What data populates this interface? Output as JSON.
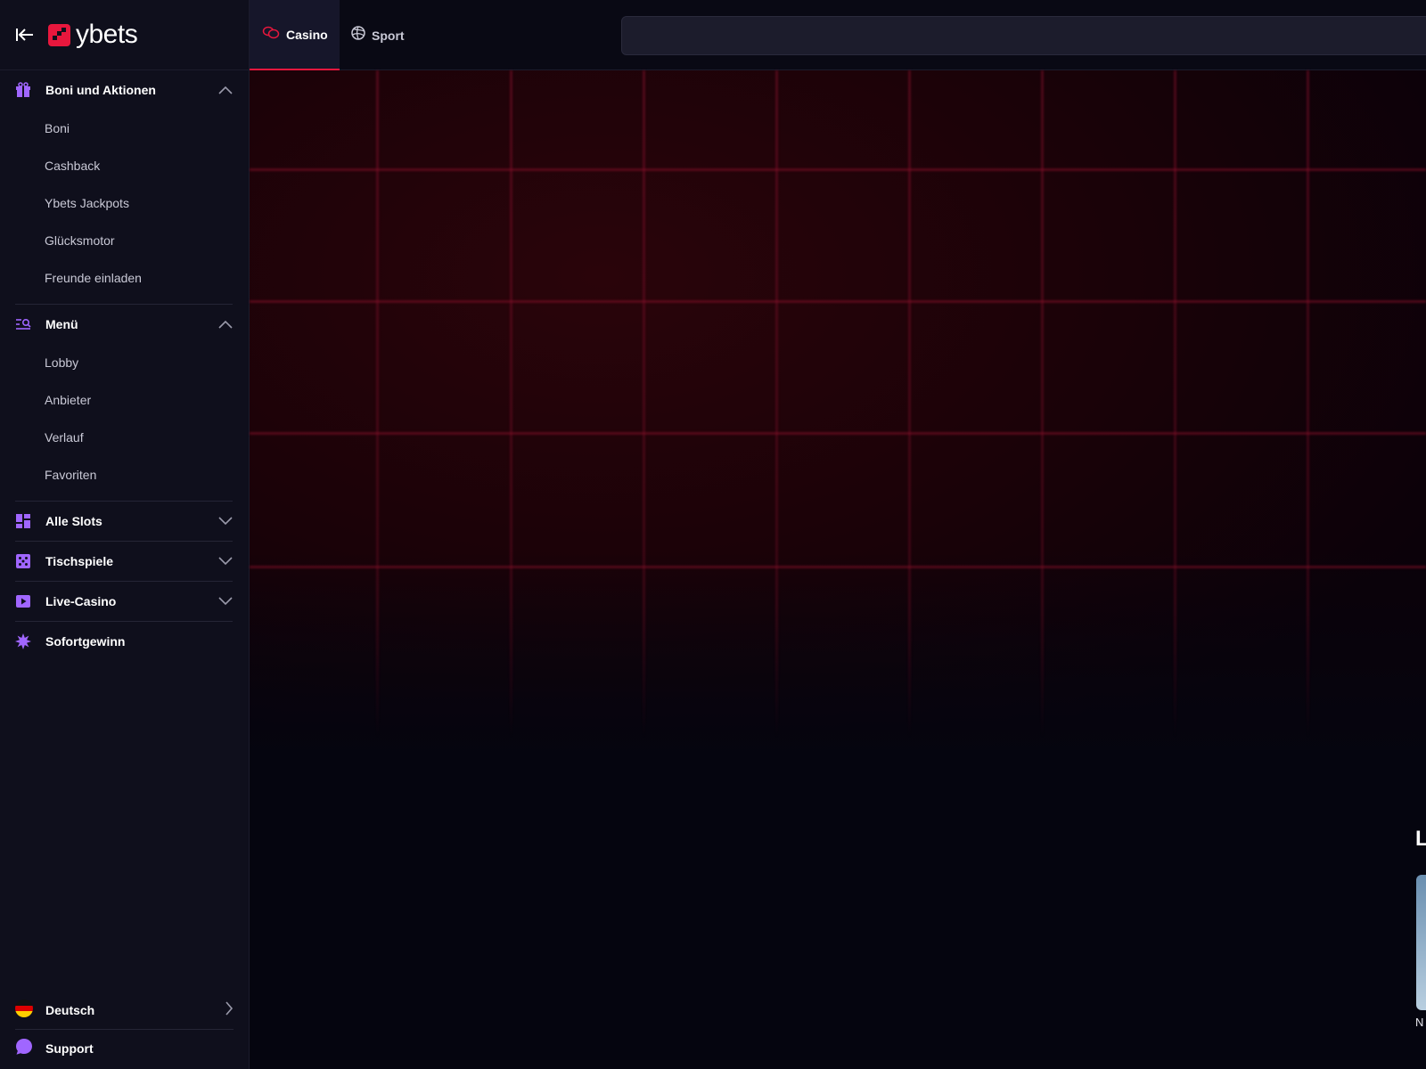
{
  "brand": {
    "name": "ybets",
    "accent": "#e8173d",
    "icon_accent": "#a066ff"
  },
  "topbar": {
    "tabs": [
      {
        "label": "Casino",
        "icon": "casino-chips-icon",
        "active": true
      },
      {
        "label": "Sport",
        "icon": "volleyball-icon",
        "active": false
      }
    ],
    "search": {
      "placeholder": "",
      "value": ""
    }
  },
  "sidebar": {
    "bonuses": {
      "label": "Boni und Aktionen",
      "icon": "gift-icon",
      "expanded": true,
      "items": [
        "Boni",
        "Cashback",
        "Ybets Jackpots",
        "Glücksmotor",
        "Freunde einladen"
      ]
    },
    "menu": {
      "label": "Menü",
      "icon": "list-search-icon",
      "expanded": true,
      "items": [
        "Lobby",
        "Anbieter",
        "Verlauf",
        "Favoriten"
      ]
    },
    "categories": [
      {
        "label": "Alle Slots",
        "icon": "grid-icon",
        "expandable": true
      },
      {
        "label": "Tischspiele",
        "icon": "dice-icon",
        "expandable": true
      },
      {
        "label": "Live-Casino",
        "icon": "play-icon",
        "expandable": true
      },
      {
        "label": "Sofortgewinn",
        "icon": "burst-icon",
        "expandable": false
      }
    ],
    "footer": {
      "language": {
        "label": "Deutsch",
        "icon": "german-flag-icon"
      },
      "support": {
        "label": "Support",
        "icon": "chat-bubble-icon"
      }
    }
  },
  "main": {
    "cutoff_heading": "L",
    "cutoff_game_name": "N"
  }
}
